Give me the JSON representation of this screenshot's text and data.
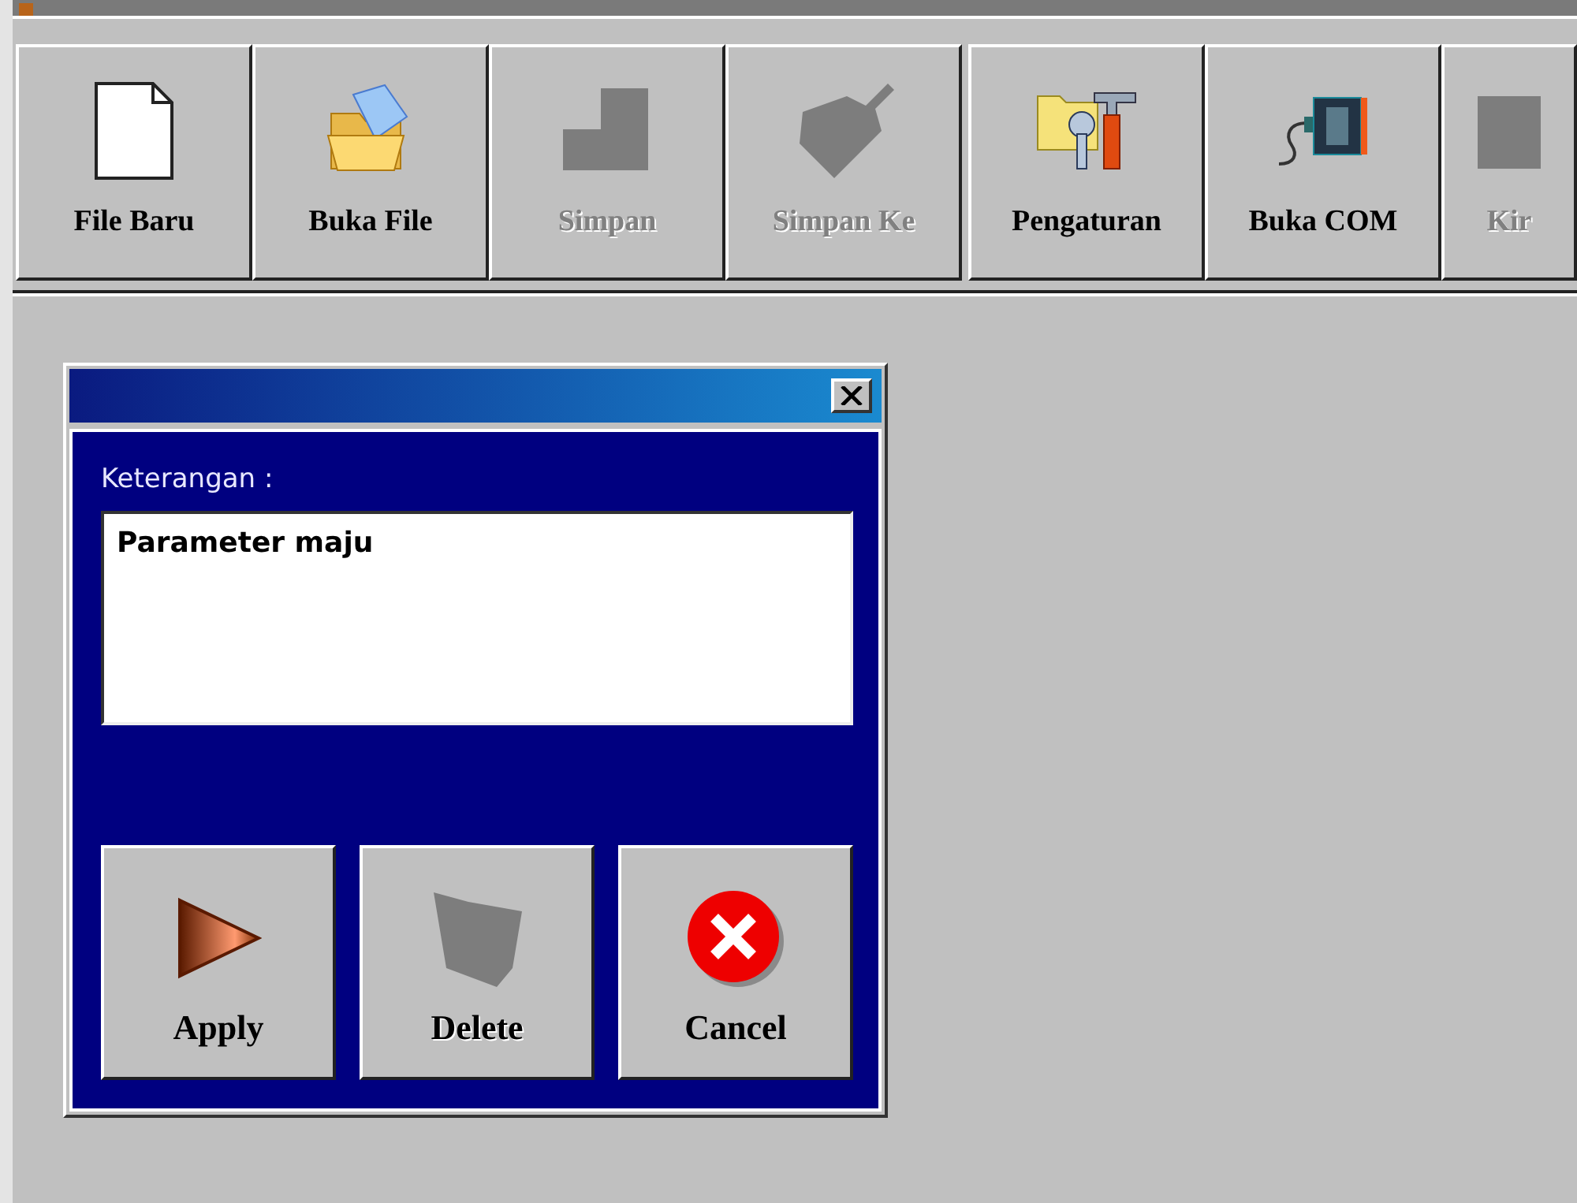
{
  "toolbar": {
    "groups": [
      [
        {
          "label": "File Baru",
          "kind": "new",
          "disabled": false
        },
        {
          "label": "Buka File",
          "kind": "open",
          "disabled": false
        },
        {
          "label": "Simpan",
          "kind": "save",
          "disabled": true
        },
        {
          "label": "Simpan Ke",
          "kind": "saveas",
          "disabled": true
        }
      ],
      [
        {
          "label": "Pengaturan",
          "kind": "settings",
          "disabled": false
        },
        {
          "label": "Buka COM",
          "kind": "com",
          "disabled": false
        },
        {
          "label": "Kir",
          "kind": "send",
          "disabled": true
        }
      ]
    ]
  },
  "dialog": {
    "field_label": "Keterangan :",
    "field_value": "Parameter maju",
    "buttons": [
      {
        "label": "Apply",
        "kind": "apply",
        "disabled": false
      },
      {
        "label": "Delete",
        "kind": "delete",
        "disabled": true
      },
      {
        "label": "Cancel",
        "kind": "cancel",
        "disabled": false
      }
    ]
  }
}
